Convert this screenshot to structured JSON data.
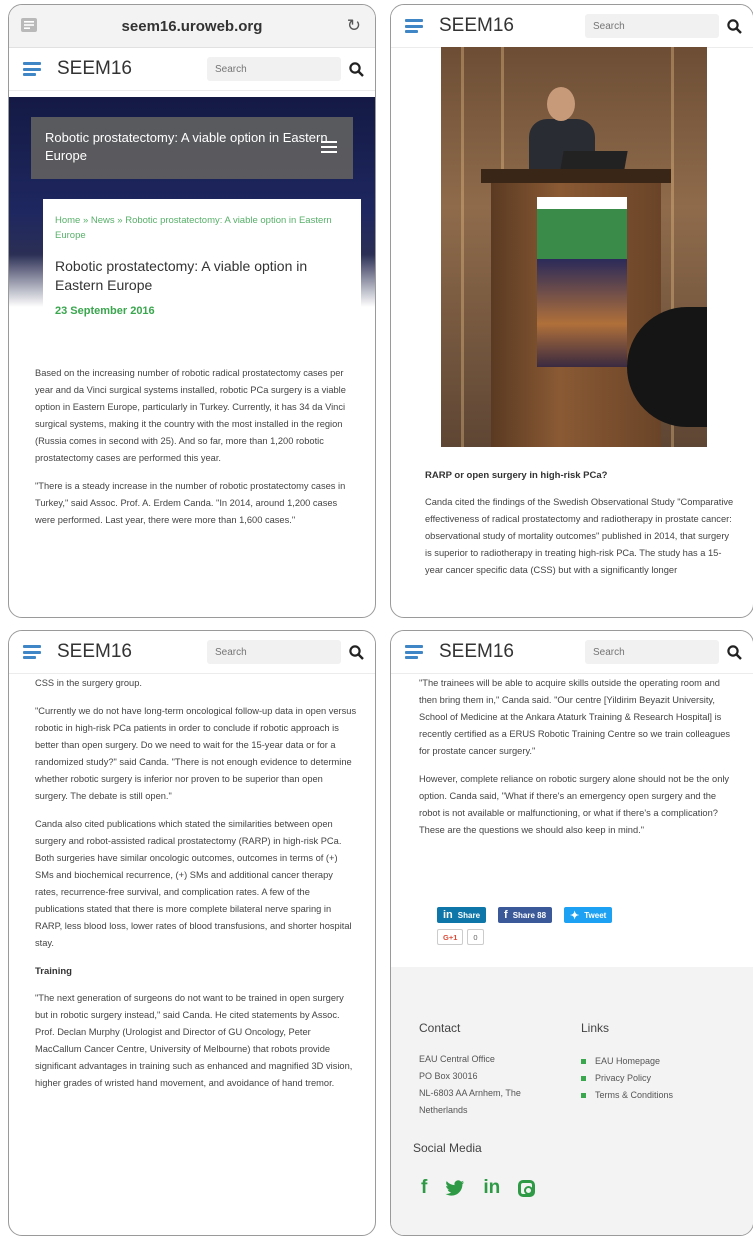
{
  "colors": {
    "accent": "#3e86c6",
    "green": "#3aa64e"
  },
  "browser": {
    "url": "seem16.uroweb.org"
  },
  "header": {
    "brand": "SEEM16",
    "search_placeholder": "Search"
  },
  "panel1": {
    "hero_title": "Robotic prostatectomy: A viable option in Eastern Europe",
    "breadcrumb": "Home » News » Robotic prostatectomy: A viable option in Eastern Europe",
    "article_title": "Robotic prostatectomy: A viable option in Eastern Europe",
    "date": "23 September 2016",
    "para1": "Based on the increasing number of robotic radical prostatectomy cases per year and da Vinci surgical systems installed, robotic PCa surgery is a viable option in Eastern Europe, particularly in Turkey. Currently, it has 34 da Vinci surgical systems, making it the country with the most installed in the region (Russia comes in second with 25). And so far, more than 1,200 robotic prostatectomy cases are performed this year.",
    "para2": "\"There is a steady increase in the number of robotic prostatectomy cases in Turkey,\" said Assoc. Prof. A. Erdem Canda. \"In 2014, around 1,200 cases were performed. Last year, there were more than 1,600 cases.\""
  },
  "panel2": {
    "heading": "RARP or open surgery in high-risk PCa?",
    "para": "Canda cited the findings of the Swedish Observational Study \"Comparative effectiveness of radical prostatectomy and radiotherapy in prostate cancer: observational study of mortality outcomes\" published in 2014, that surgery is superior to radiotherapy in treating high-risk PCa. The study has a 15-year cancer specific data (CSS) but with a significantly longer"
  },
  "panel3": {
    "line0": "CSS in the surgery group.",
    "para1": "\"Currently we do not have long-term oncological follow-up data in open versus robotic in high-risk PCa patients in order to conclude if robotic approach is better than open surgery. Do we need to wait for the 15-year data or for a randomized study?\" said Canda. \"There is not enough evidence to determine whether robotic surgery is inferior nor proven to be superior than open surgery. The debate is still open.\"",
    "para2": "Canda also cited publications which stated the similarities between open surgery and robot-assisted radical prostatectomy (RARP) in high-risk PCa. Both surgeries have similar oncologic outcomes, outcomes in terms of (+) SMs and biochemical recurrence, (+) SMs and additional cancer therapy rates, recurrence-free survival, and complication rates. A few of the publications stated that there is more complete bilateral nerve sparing in RARP, less blood loss, lower rates of blood transfusions, and shorter hospital stay.",
    "heading": "Training",
    "para3": "\"The next generation of surgeons do not want to be trained in open surgery but in robotic surgery instead,\" said Canda. He cited statements by Assoc. Prof. Declan Murphy (Urologist and Director of GU Oncology, Peter MacCallum Cancer Centre, University of Melbourne) that robots provide significant advantages in training such as enhanced and magnified 3D vision, higher grades of wristed hand movement, and avoidance of hand tremor."
  },
  "panel4": {
    "para1": "\"The trainees will be able to acquire skills outside the operating room and then bring them in,\" Canda said. \"Our centre [Yildirim Beyazit University, School of Medicine at the Ankara Ataturk Training & Research Hospital] is recently certified as a ERUS Robotic Training Centre so we train colleagues for prostate cancer surgery.\"",
    "para2": "However, complete reliance on robotic surgery alone should not be the only option. Canda said, \"What if there's an emergency open surgery and the robot is not available or malfunctioning, or what if there's a complication? These are the questions we should also keep in mind.\"",
    "share": {
      "linkedin": "Share",
      "facebook": "Share 88",
      "twitter": "Tweet",
      "gplus": "G+1",
      "gcount": "0"
    },
    "footer": {
      "contact_heading": "Contact",
      "address": [
        "EAU Central Office",
        "PO Box 30016",
        "NL-6803 AA Arnhem, The",
        "Netherlands"
      ],
      "links_heading": "Links",
      "links": [
        "EAU Homepage",
        "Privacy Policy",
        "Terms & Conditions"
      ],
      "social_heading": "Social Media",
      "social_icons": [
        "facebook-icon",
        "twitter-icon",
        "linkedin-icon",
        "instagram-icon"
      ]
    }
  }
}
